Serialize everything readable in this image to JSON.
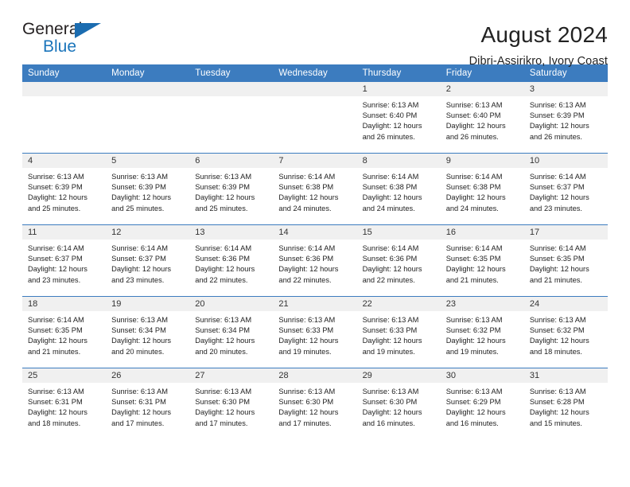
{
  "brand": {
    "name_top": "General",
    "name_bottom": "Blue",
    "accent_color": "#1b75bb",
    "triangle_icon": "triangle-icon"
  },
  "header": {
    "title": "August 2024",
    "subtitle": "Dibri-Assirikro, Ivory Coast"
  },
  "calendar": {
    "header_bg": "#3c7cbf",
    "daynum_bg": "#f0f0f0",
    "weekdays": [
      "Sunday",
      "Monday",
      "Tuesday",
      "Wednesday",
      "Thursday",
      "Friday",
      "Saturday"
    ],
    "weeks": [
      [
        {
          "empty": true
        },
        {
          "empty": true
        },
        {
          "empty": true
        },
        {
          "empty": true
        },
        {
          "day": "1",
          "sunrise": "Sunrise: 6:13 AM",
          "sunset": "Sunset: 6:40 PM",
          "daylight": "Daylight: 12 hours and 26 minutes."
        },
        {
          "day": "2",
          "sunrise": "Sunrise: 6:13 AM",
          "sunset": "Sunset: 6:40 PM",
          "daylight": "Daylight: 12 hours and 26 minutes."
        },
        {
          "day": "3",
          "sunrise": "Sunrise: 6:13 AM",
          "sunset": "Sunset: 6:39 PM",
          "daylight": "Daylight: 12 hours and 26 minutes."
        }
      ],
      [
        {
          "day": "4",
          "sunrise": "Sunrise: 6:13 AM",
          "sunset": "Sunset: 6:39 PM",
          "daylight": "Daylight: 12 hours and 25 minutes."
        },
        {
          "day": "5",
          "sunrise": "Sunrise: 6:13 AM",
          "sunset": "Sunset: 6:39 PM",
          "daylight": "Daylight: 12 hours and 25 minutes."
        },
        {
          "day": "6",
          "sunrise": "Sunrise: 6:13 AM",
          "sunset": "Sunset: 6:39 PM",
          "daylight": "Daylight: 12 hours and 25 minutes."
        },
        {
          "day": "7",
          "sunrise": "Sunrise: 6:14 AM",
          "sunset": "Sunset: 6:38 PM",
          "daylight": "Daylight: 12 hours and 24 minutes."
        },
        {
          "day": "8",
          "sunrise": "Sunrise: 6:14 AM",
          "sunset": "Sunset: 6:38 PM",
          "daylight": "Daylight: 12 hours and 24 minutes."
        },
        {
          "day": "9",
          "sunrise": "Sunrise: 6:14 AM",
          "sunset": "Sunset: 6:38 PM",
          "daylight": "Daylight: 12 hours and 24 minutes."
        },
        {
          "day": "10",
          "sunrise": "Sunrise: 6:14 AM",
          "sunset": "Sunset: 6:37 PM",
          "daylight": "Daylight: 12 hours and 23 minutes."
        }
      ],
      [
        {
          "day": "11",
          "sunrise": "Sunrise: 6:14 AM",
          "sunset": "Sunset: 6:37 PM",
          "daylight": "Daylight: 12 hours and 23 minutes."
        },
        {
          "day": "12",
          "sunrise": "Sunrise: 6:14 AM",
          "sunset": "Sunset: 6:37 PM",
          "daylight": "Daylight: 12 hours and 23 minutes."
        },
        {
          "day": "13",
          "sunrise": "Sunrise: 6:14 AM",
          "sunset": "Sunset: 6:36 PM",
          "daylight": "Daylight: 12 hours and 22 minutes."
        },
        {
          "day": "14",
          "sunrise": "Sunrise: 6:14 AM",
          "sunset": "Sunset: 6:36 PM",
          "daylight": "Daylight: 12 hours and 22 minutes."
        },
        {
          "day": "15",
          "sunrise": "Sunrise: 6:14 AM",
          "sunset": "Sunset: 6:36 PM",
          "daylight": "Daylight: 12 hours and 22 minutes."
        },
        {
          "day": "16",
          "sunrise": "Sunrise: 6:14 AM",
          "sunset": "Sunset: 6:35 PM",
          "daylight": "Daylight: 12 hours and 21 minutes."
        },
        {
          "day": "17",
          "sunrise": "Sunrise: 6:14 AM",
          "sunset": "Sunset: 6:35 PM",
          "daylight": "Daylight: 12 hours and 21 minutes."
        }
      ],
      [
        {
          "day": "18",
          "sunrise": "Sunrise: 6:14 AM",
          "sunset": "Sunset: 6:35 PM",
          "daylight": "Daylight: 12 hours and 21 minutes."
        },
        {
          "day": "19",
          "sunrise": "Sunrise: 6:13 AM",
          "sunset": "Sunset: 6:34 PM",
          "daylight": "Daylight: 12 hours and 20 minutes."
        },
        {
          "day": "20",
          "sunrise": "Sunrise: 6:13 AM",
          "sunset": "Sunset: 6:34 PM",
          "daylight": "Daylight: 12 hours and 20 minutes."
        },
        {
          "day": "21",
          "sunrise": "Sunrise: 6:13 AM",
          "sunset": "Sunset: 6:33 PM",
          "daylight": "Daylight: 12 hours and 19 minutes."
        },
        {
          "day": "22",
          "sunrise": "Sunrise: 6:13 AM",
          "sunset": "Sunset: 6:33 PM",
          "daylight": "Daylight: 12 hours and 19 minutes."
        },
        {
          "day": "23",
          "sunrise": "Sunrise: 6:13 AM",
          "sunset": "Sunset: 6:32 PM",
          "daylight": "Daylight: 12 hours and 19 minutes."
        },
        {
          "day": "24",
          "sunrise": "Sunrise: 6:13 AM",
          "sunset": "Sunset: 6:32 PM",
          "daylight": "Daylight: 12 hours and 18 minutes."
        }
      ],
      [
        {
          "day": "25",
          "sunrise": "Sunrise: 6:13 AM",
          "sunset": "Sunset: 6:31 PM",
          "daylight": "Daylight: 12 hours and 18 minutes."
        },
        {
          "day": "26",
          "sunrise": "Sunrise: 6:13 AM",
          "sunset": "Sunset: 6:31 PM",
          "daylight": "Daylight: 12 hours and 17 minutes."
        },
        {
          "day": "27",
          "sunrise": "Sunrise: 6:13 AM",
          "sunset": "Sunset: 6:30 PM",
          "daylight": "Daylight: 12 hours and 17 minutes."
        },
        {
          "day": "28",
          "sunrise": "Sunrise: 6:13 AM",
          "sunset": "Sunset: 6:30 PM",
          "daylight": "Daylight: 12 hours and 17 minutes."
        },
        {
          "day": "29",
          "sunrise": "Sunrise: 6:13 AM",
          "sunset": "Sunset: 6:30 PM",
          "daylight": "Daylight: 12 hours and 16 minutes."
        },
        {
          "day": "30",
          "sunrise": "Sunrise: 6:13 AM",
          "sunset": "Sunset: 6:29 PM",
          "daylight": "Daylight: 12 hours and 16 minutes."
        },
        {
          "day": "31",
          "sunrise": "Sunrise: 6:13 AM",
          "sunset": "Sunset: 6:28 PM",
          "daylight": "Daylight: 12 hours and 15 minutes."
        }
      ]
    ]
  }
}
